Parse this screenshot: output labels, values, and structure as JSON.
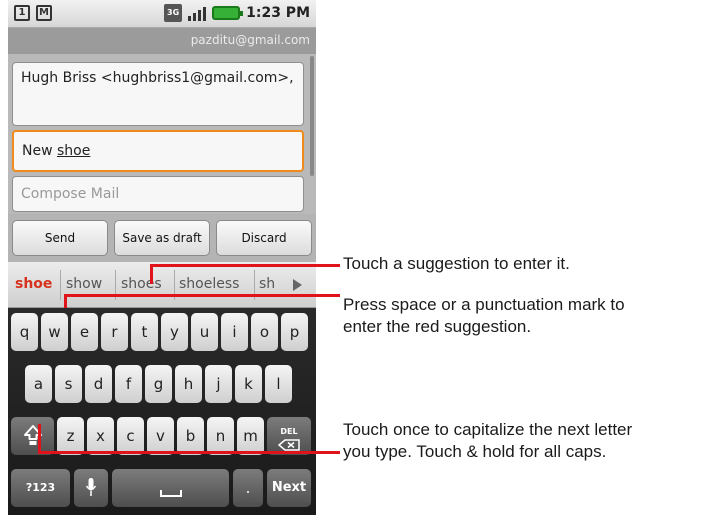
{
  "status_bar": {
    "sim_icon": "sim-card-icon",
    "gmail_icon": "gmail-notification-icon",
    "network_label": "3G",
    "time": "1:23 PM"
  },
  "account": {
    "email": "pazditu@gmail.com"
  },
  "compose": {
    "to_text": "Hugh Briss <hughbriss1@gmail.com>,",
    "subject_prefix": "New ",
    "subject_word": "shoe",
    "body_placeholder": "Compose Mail"
  },
  "buttons": {
    "send": "Send",
    "save_draft": "Save as draft",
    "discard": "Discard"
  },
  "suggestions": [
    "shoe",
    "show",
    "shoes",
    "shoeless",
    "sh"
  ],
  "keyboard": {
    "row1": [
      "q",
      "w",
      "e",
      "r",
      "t",
      "y",
      "u",
      "i",
      "o",
      "p"
    ],
    "row2": [
      "a",
      "s",
      "d",
      "f",
      "g",
      "h",
      "j",
      "k",
      "l"
    ],
    "row3": [
      "z",
      "x",
      "c",
      "v",
      "b",
      "n",
      "m"
    ],
    "shift_icon": "shift-arrow-icon",
    "delete_label": "DEL",
    "symbols_label": "?123",
    "mic_icon": "microphone-icon",
    "space_icon": "space-bar-icon",
    "period_label": ".",
    "next_label": "Next"
  },
  "callouts": {
    "suggestion": "Touch a suggestion to enter it.",
    "space_1": "Press space or a punctuation mark to",
    "space_2": "enter the red suggestion.",
    "shift_1": "Touch once to capitalize the next letter",
    "shift_2": "you type. Touch & hold for all caps."
  },
  "colors": {
    "callout_line": "#e0121c",
    "subject_focus": "#f08a1a",
    "suggestion_highlight": "#d6321c"
  }
}
